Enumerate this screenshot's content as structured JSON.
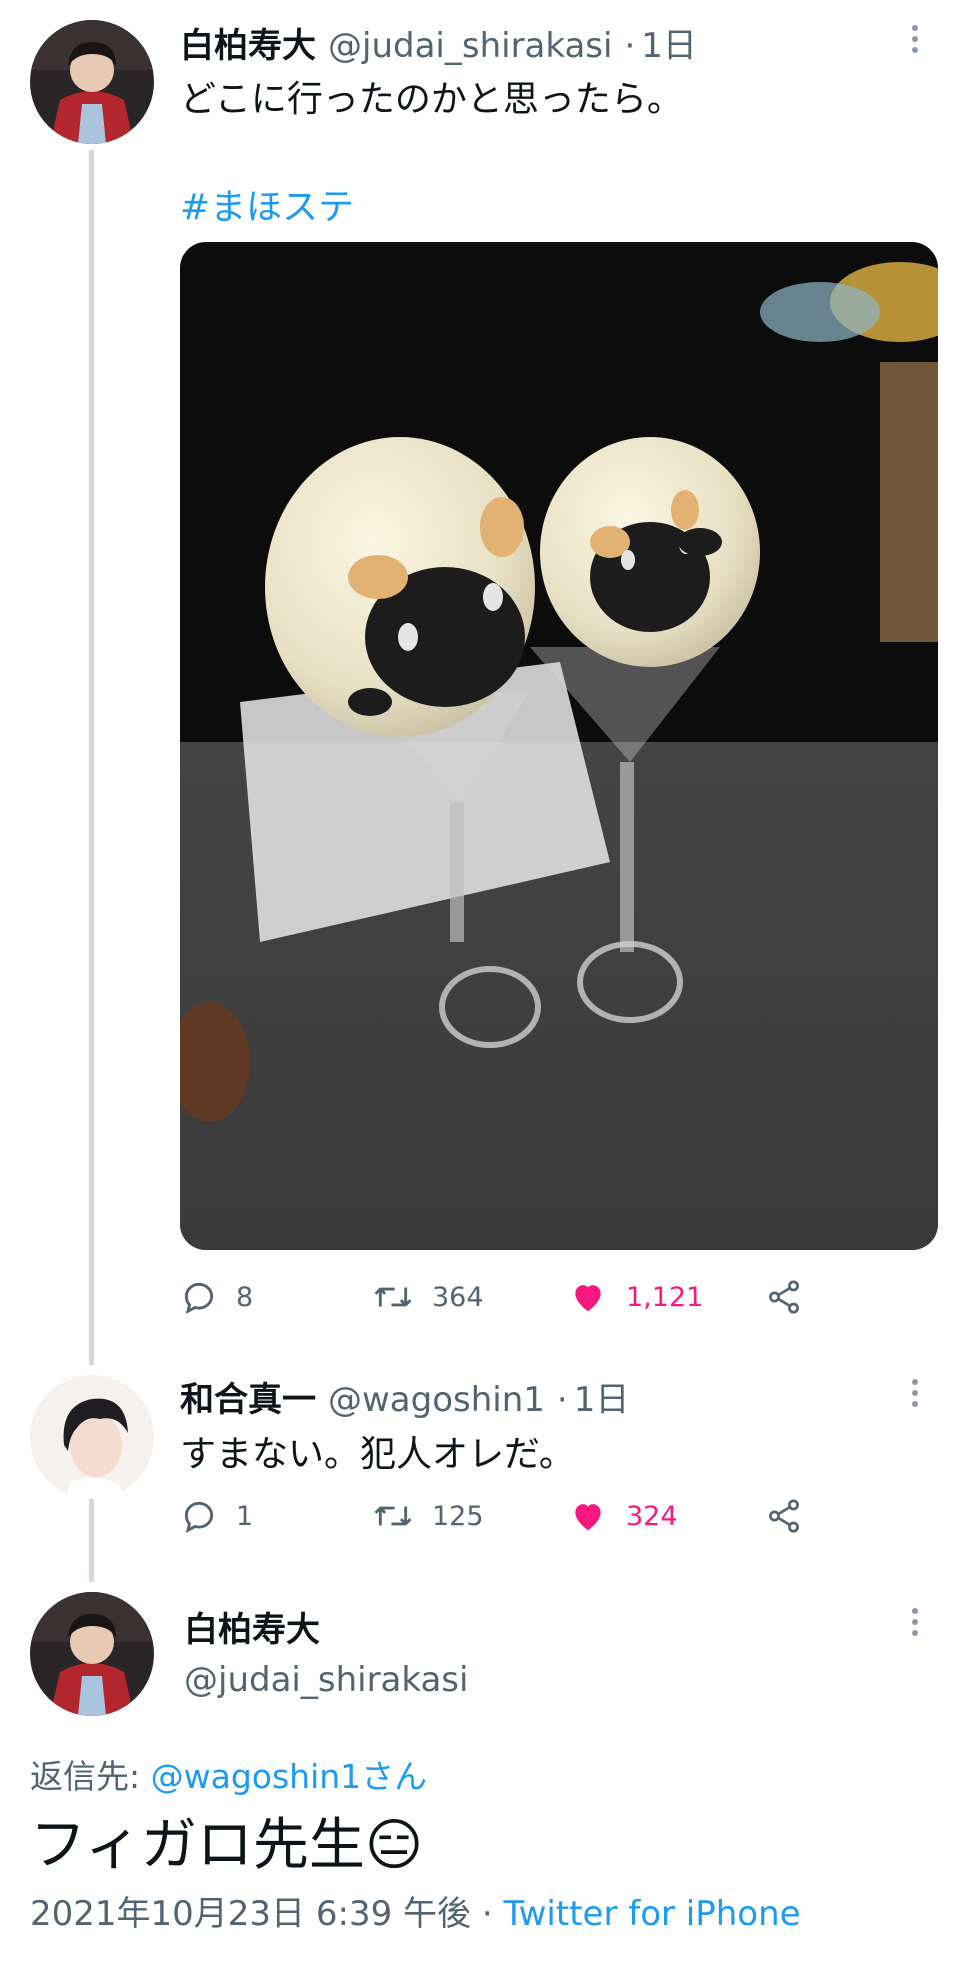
{
  "tweet1": {
    "name": "白柏寿大",
    "handle": "@judai_shirakasi",
    "separator": "·",
    "time": "1日",
    "text": "どこに行ったのかと思ったら。",
    "hashtag": "#まほステ",
    "photo_icon": "sheep-plush-photo",
    "actions": {
      "replies": "8",
      "retweets": "364",
      "likes": "1,121"
    }
  },
  "tweet2": {
    "name": "和合真一",
    "handle": "@wagoshin1",
    "separator": "·",
    "time": "1日",
    "text": "すまない。犯人オレだ。",
    "actions": {
      "replies": "1",
      "retweets": "125",
      "likes": "324"
    }
  },
  "tweet3": {
    "name": "白柏寿大",
    "handle": "@judai_shirakasi",
    "reply_label": "返信先:",
    "reply_to": "@wagoshin1さん",
    "text": "フィガロ先生",
    "emoji": "😑",
    "timestamp": "2021年10月23日 6:39 午後",
    "separator": "·",
    "source": "Twitter for iPhone"
  },
  "icons": [
    "reply-icon",
    "retweet-icon",
    "heart-icon",
    "share-icon",
    "more-icon"
  ],
  "colors": {
    "accent": "#1d9bf0",
    "like": "#f91880",
    "muted": "#536471",
    "thread": "#cfd9de"
  }
}
